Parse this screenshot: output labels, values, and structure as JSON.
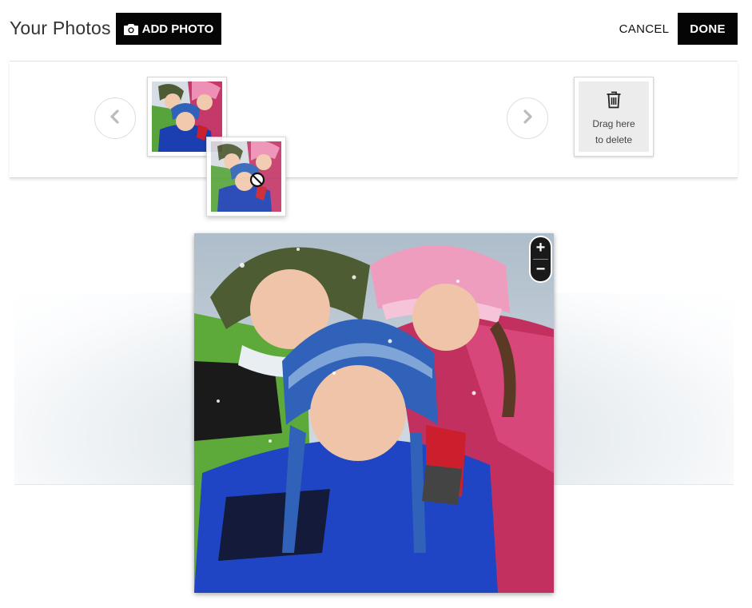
{
  "header": {
    "title": "Your Photos",
    "add_photo_label": "ADD PHOTO",
    "cancel_label": "CANCEL",
    "done_label": "DONE"
  },
  "tray": {
    "trash_line1": "Drag here",
    "trash_line2": "to delete",
    "prev_icon": "chevron-left-icon",
    "next_icon": "chevron-right-icon",
    "trash_icon": "trash-icon",
    "drag_cursor_icon": "no-drop-icon"
  },
  "editor": {
    "zoom_in_label": "+",
    "zoom_out_label": "−"
  },
  "colors": {
    "button_bg": "#050505",
    "button_text": "#ffffff",
    "trash_bg": "#ececec"
  }
}
